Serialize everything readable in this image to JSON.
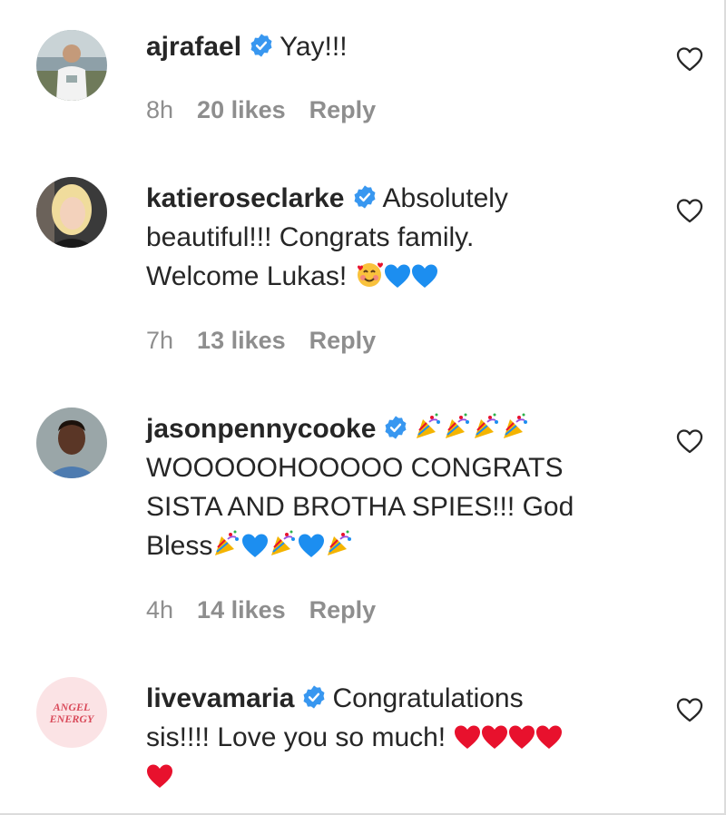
{
  "comments": [
    {
      "username": "ajrafael",
      "text": "Yay!!!",
      "time": "8h",
      "likes": "20 likes",
      "reply": "Reply"
    },
    {
      "username": "katieroseclarke",
      "text_line1": "Absolutely",
      "text_line2": "beautiful!!! Congrats family.",
      "text_line3": "Welcome Lukas!",
      "time": "7h",
      "likes": "13 likes",
      "reply": "Reply"
    },
    {
      "username": "jasonpennycooke",
      "text_line2": "WOOOOOHOOOOO CONGRATS",
      "text_line3": "SISTA AND BROTHA SPIES!!! God",
      "text_line4": "Bless",
      "time": "4h",
      "likes": "14 likes",
      "reply": "Reply"
    },
    {
      "username": "livevamaria",
      "text_line1": "Congratulations",
      "text_line2": "sis!!!! Love you so much!",
      "avatar_logo_text": [
        "ANGEL",
        "ENERGY"
      ],
      "time": "",
      "likes": "",
      "reply": ""
    }
  ],
  "colors": {
    "verified_blue": "#3897f0",
    "meta_gray": "#8e8e8e",
    "text": "#262626",
    "heart_red": "#e8112d",
    "blue_heart": "#1c8ef0"
  },
  "icons": {
    "verified": "verified-badge-icon",
    "like": "heart-outline-icon",
    "emoji_smiling_hearts": "smiling-face-with-hearts-emoji",
    "emoji_blue_heart": "blue-heart-emoji",
    "emoji_party_popper": "party-popper-emoji",
    "emoji_red_heart": "red-heart-emoji"
  }
}
